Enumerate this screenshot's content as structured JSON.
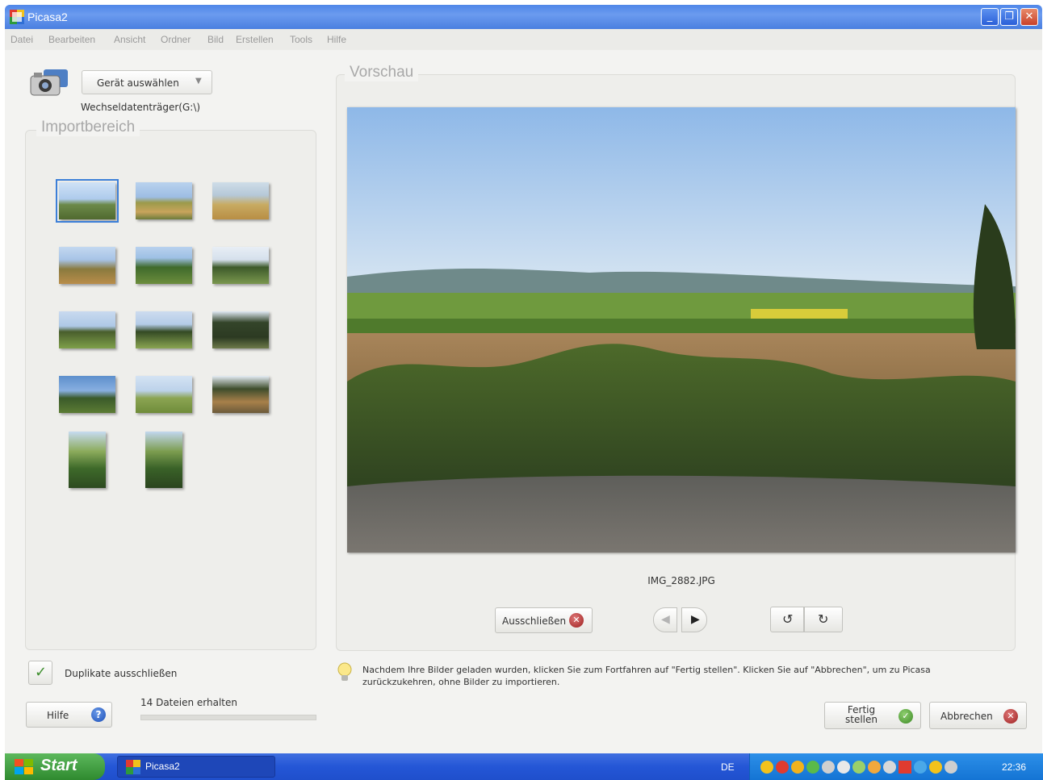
{
  "window": {
    "title": "Picasa2",
    "controls": {
      "minimize": "_",
      "restore": "❐",
      "close": "✕"
    }
  },
  "menu": [
    "Datei",
    "Bearbeiten",
    "Ansicht",
    "Ordner",
    "Bild",
    "Erstellen",
    "Tools",
    "Hilfe"
  ],
  "device": {
    "button_label": "Gerät auswählen",
    "drive": "Wechseldatenträger(G:\\)"
  },
  "import": {
    "title": "Importbereich",
    "thumbnails": [
      "landscape-1",
      "landscape-2",
      "landscape-3",
      "landscape-4",
      "landscape-5",
      "landscape-6",
      "landscape-7",
      "landscape-8",
      "landscape-9",
      "landscape-10",
      "landscape-11",
      "landscape-12",
      "portrait-13",
      "portrait-14"
    ],
    "selected_index": 0
  },
  "preview": {
    "title": "Vorschau",
    "filename": "IMG_2882.JPG",
    "exclude_label": "Ausschließen"
  },
  "options": {
    "duplicates_label": "Duplikate ausschließen",
    "duplicates_checked": true
  },
  "help_label": "Hilfe",
  "status": {
    "files_received": "14 Dateien erhalten",
    "progress": 0
  },
  "info_text": "Nachdem Ihre Bilder geladen wurden, klicken Sie zum Fortfahren auf \"Fertig stellen\". Klicken Sie auf \"Abbrechen\", um zu Picasa zurückzukehren, ohne Bilder zu importieren.",
  "actions": {
    "finish_line1": "Fertig",
    "finish_line2": "stellen",
    "cancel": "Abbrechen"
  },
  "taskbar": {
    "start": "Start",
    "task": "Picasa2",
    "language": "DE",
    "clock": "22:36"
  },
  "colors": {
    "titlebar": "#4f86e8",
    "taskbar": "#2456d6",
    "start": "#3c9a3c",
    "selected_outline": "#3c7fd8"
  }
}
